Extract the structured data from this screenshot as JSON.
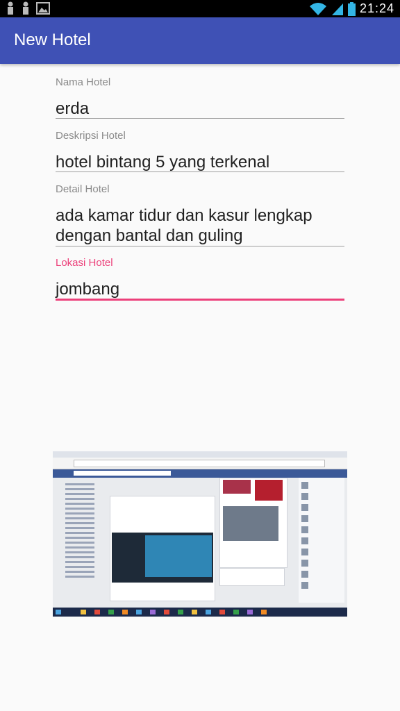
{
  "status_bar": {
    "time": "21:24",
    "icons": [
      "notification-icon",
      "notification-icon",
      "image-icon",
      "wifi-icon",
      "signal-icon",
      "battery-icon"
    ]
  },
  "app_bar": {
    "title": "New Hotel"
  },
  "form": {
    "nama": {
      "label": "Nama Hotel",
      "value": "erda"
    },
    "deskripsi": {
      "label": "Deskripsi Hotel",
      "value": "hotel bintang 5 yang terkenal"
    },
    "detail": {
      "label": "Detail Hotel",
      "value": "ada kamar tidur dan kasur lengkap dengan bantal dan guling"
    },
    "lokasi": {
      "label": "Lokasi Hotel",
      "value": "jombang"
    }
  },
  "colors": {
    "primary": "#3f51b5",
    "accent": "#ec407a",
    "label": "#8a8a8a",
    "text": "#212121",
    "line": "#9e9e9e"
  }
}
